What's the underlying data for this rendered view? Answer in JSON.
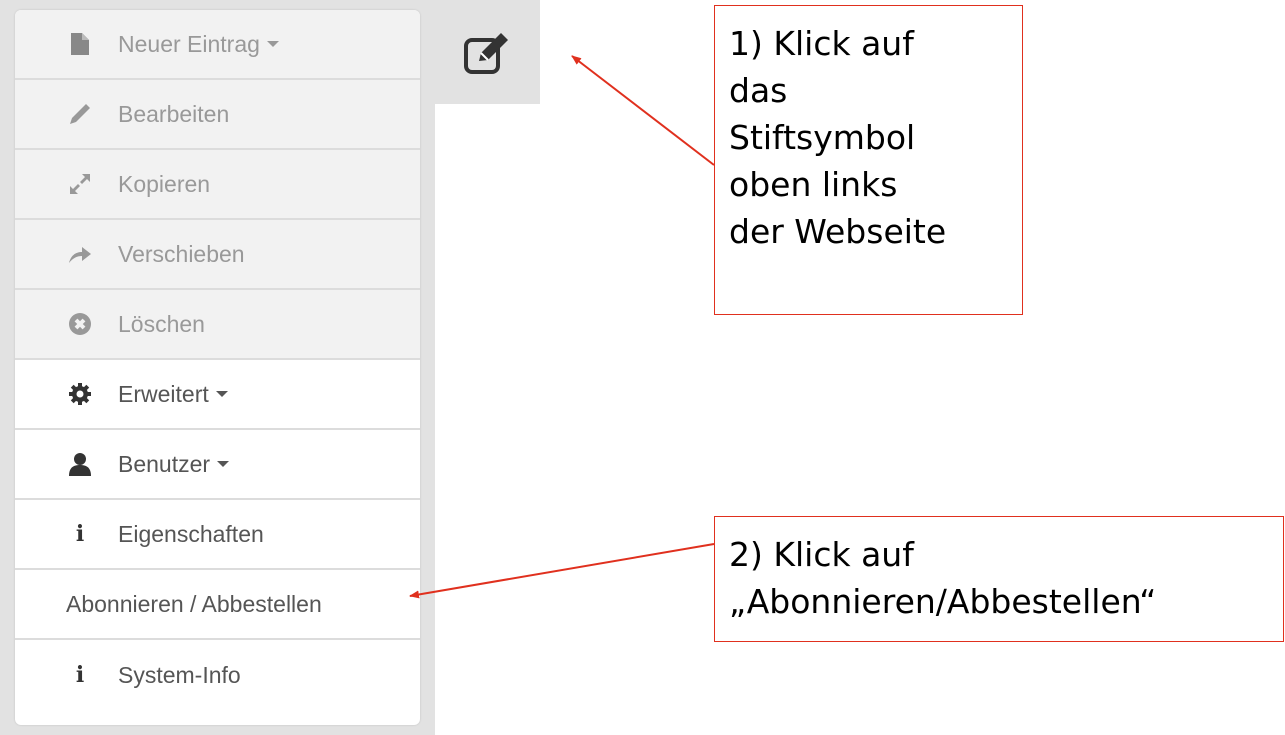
{
  "menu": {
    "items": [
      {
        "label": "Neuer Eintrag",
        "icon": "file-icon",
        "disabled": true,
        "dropdown": true
      },
      {
        "label": "Bearbeiten",
        "icon": "pencil-icon",
        "disabled": true,
        "dropdown": false
      },
      {
        "label": "Kopieren",
        "icon": "resize-arrows-icon",
        "disabled": true,
        "dropdown": false
      },
      {
        "label": "Verschieben",
        "icon": "arrow-right-icon",
        "disabled": true,
        "dropdown": false
      },
      {
        "label": "Löschen",
        "icon": "delete-circle-icon",
        "disabled": true,
        "dropdown": false
      },
      {
        "label": "Erweitert",
        "icon": "gear-icon",
        "disabled": false,
        "dropdown": true
      },
      {
        "label": "Benutzer",
        "icon": "user-icon",
        "disabled": false,
        "dropdown": true
      },
      {
        "label": "Eigenschaften",
        "icon": "info-icon",
        "disabled": false,
        "dropdown": false
      },
      {
        "label": "Abonnieren / Abbestellen",
        "icon": null,
        "disabled": false,
        "dropdown": false
      },
      {
        "label": "System-Info",
        "icon": "info-icon",
        "disabled": false,
        "dropdown": false
      }
    ]
  },
  "edit_button": {
    "icon": "edit-square-icon"
  },
  "callouts": {
    "step1": {
      "lines": [
        "1) Klick auf",
        "das",
        "Stiftsymbol",
        "oben links",
        "der Webseite"
      ]
    },
    "step2": {
      "lines": [
        "2) Klick auf",
        "„Abonnieren/Abbestellen“"
      ]
    }
  },
  "colors": {
    "annotation_red": "#e0301e",
    "disabled_bg": "#f2f2f2",
    "backdrop": "#e2e2e2"
  }
}
